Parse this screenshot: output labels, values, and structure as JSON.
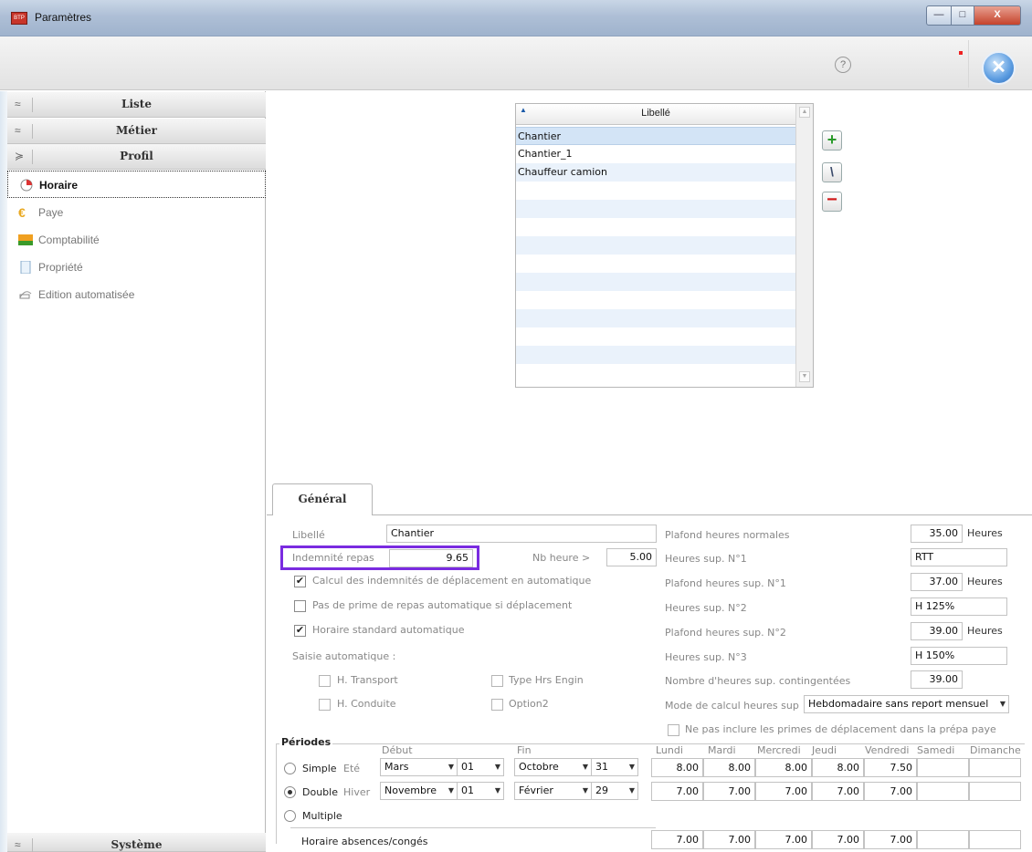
{
  "window": {
    "title": "Paramètres",
    "app_icon_text": "BTP",
    "minimize": "—",
    "maximize": "□",
    "close": "X"
  },
  "toolbar": {
    "help": "?",
    "exit": "✕"
  },
  "nav": {
    "sections": [
      "Liste",
      "Métier",
      "Profil"
    ],
    "items": [
      "Horaire",
      "Paye",
      "Comptabilité",
      "Propriété",
      "Edition automatisée"
    ],
    "bottom_section": "Système"
  },
  "grid": {
    "column": "Libellé",
    "rows": [
      "Chantier",
      "Chantier_1",
      "Chauffeur camion"
    ]
  },
  "tabs": {
    "general": "Général"
  },
  "form": {
    "libelle_label": "Libellé",
    "libelle_value": "Chantier",
    "indemnite_label": "Indemnité repas",
    "indemnite_value": "9.65",
    "nb_heure_label": "Nb heure >",
    "nb_heure_value": "5.00",
    "calc_deplacement": "Calcul des indemnités de déplacement en automatique",
    "pas_prime": "Pas de prime de repas automatique si déplacement",
    "horaire_standard": "Horaire standard automatique",
    "saisie_auto": "Saisie automatique :",
    "h_transport": "H. Transport",
    "type_hrs_engin": "Type Hrs Engin",
    "h_conduite": "H. Conduite",
    "option2": "Option2",
    "plafond_normales_label": "Plafond heures normales",
    "plafond_normales_value": "35.00",
    "heures_unit": "Heures",
    "hs1_label": "Heures sup. N°1",
    "hs1_value": "RTT",
    "plafond_hs1_label": "Plafond heures sup. N°1",
    "plafond_hs1_value": "37.00",
    "hs2_label": "Heures sup. N°2",
    "hs2_value": "H 125%",
    "plafond_hs2_label": "Plafond heures sup. N°2",
    "plafond_hs2_value": "39.00",
    "hs3_label": "Heures sup. N°3",
    "hs3_value": "H 150%",
    "contingentees_label": "Nombre d'heures sup. contingentées",
    "contingentees_value": "39.00",
    "mode_calc_label": "Mode de calcul heures sup",
    "mode_calc_value": "Hebdomadaire sans report mensuel",
    "ne_pas_inclure": "Ne pas inclure les primes de déplacement dans la prépa paye"
  },
  "periods": {
    "title": "Périodes",
    "debut": "Début",
    "fin": "Fin",
    "days": [
      "Lundi",
      "Mardi",
      "Mercredi",
      "Jeudi",
      "Vendredi",
      "Samedi",
      "Dimanche"
    ],
    "simple_label": "Simple",
    "simple_season": "Eté",
    "simple_start_month": "Mars",
    "simple_start_day": "01",
    "simple_end_month": "Octobre",
    "simple_end_day": "31",
    "simple_hours": [
      "8.00",
      "8.00",
      "8.00",
      "8.00",
      "7.50",
      "",
      ""
    ],
    "double_label": "Double",
    "double_season": "Hiver",
    "double_start_month": "Novembre",
    "double_start_day": "01",
    "double_end_month": "Février",
    "double_end_day": "29",
    "double_hours": [
      "7.00",
      "7.00",
      "7.00",
      "7.00",
      "7.00",
      "",
      ""
    ],
    "multiple_label": "Multiple",
    "absences_label": "Horaire absences/congés",
    "absences_hours": [
      "7.00",
      "7.00",
      "7.00",
      "7.00",
      "7.00",
      "",
      ""
    ]
  }
}
